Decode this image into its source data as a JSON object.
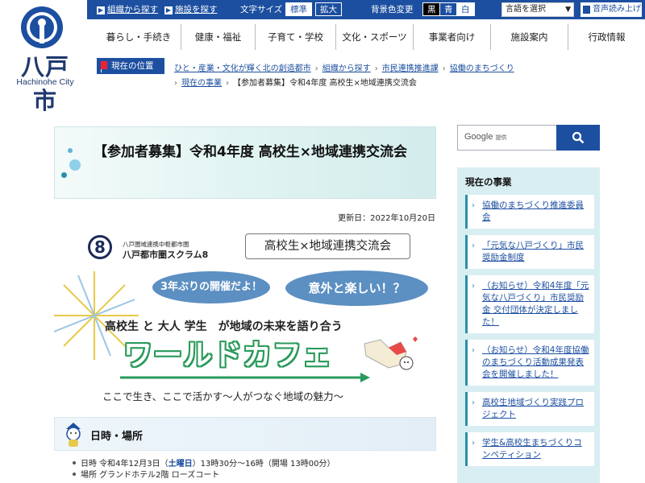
{
  "logo": {
    "city": "八戸市",
    "en": "Hachinohe City",
    "icon": "city-emblem-icon"
  },
  "topbar": {
    "search_org": "組織から探す",
    "search_facility": "施設を探す",
    "font_size_label": "文字サイズ",
    "font_std": "標準",
    "font_big": "拡大",
    "bg_label": "背景色変更",
    "bg_black": "黒",
    "bg_blue": "青",
    "bg_white": "白",
    "lang_select": "言語を選択",
    "read_aloud": "音声読み上げ"
  },
  "nav": {
    "items": [
      "暮らし・手続き",
      "健康・福祉",
      "子育て・学校",
      "文化・スポーツ",
      "事業者向け",
      "施設案内",
      "行政情報"
    ]
  },
  "breadcrumb": {
    "badge": "現在の位置",
    "l1": "ひと・産業・文化が輝く北の創造都市",
    "l2": "組織から探す",
    "l3": "市民連携推進課",
    "l4": "協働のまちづくり",
    "l5": "現在の事業",
    "current": "【参加者募集】令和4年度 高校生×地域連携交流会"
  },
  "main": {
    "title": "【参加者募集】令和4年度 高校生×地域連携交流会",
    "updated": "更新日：2022年10月20日",
    "banner": {
      "scrum_small": "八戸圏域連携中枢都市圏",
      "scrum_big": "八戸都市圏スクラム8",
      "scrum_mark": "8",
      "subtitle": "高校生×地域連携交流会",
      "bubble1": "3年ぶりの開催だよ！",
      "bubble2": "意外と楽しい！？",
      "sub2": "高校生 と 大人 学生　が地域の未来を語り合う",
      "world_cafe": "ワールドカフェ",
      "tagline": "ここで生き、ここで活かす～人がつなぐ地域の魅力～"
    },
    "section_title": "日時・場所",
    "info": {
      "date_prefix": "日時 令和4年12月3日（",
      "date_day": "土曜日",
      "date_suffix": "）13時30分～16時（開場 13時00分）",
      "place": "場所 グランドホテル2階 ローズコート"
    }
  },
  "sidebar": {
    "search_google": "Google",
    "search_provided": "提供",
    "search_icon": "search-icon",
    "panel_title": "現在の事業",
    "items": [
      "協働のまちづくり推進委員会",
      "「元気な八戸づくり」市民奨励金制度",
      "（お知らせ）令和4年度「元気な八戸づくり」市民奨励金 交付団体が決定しました！",
      "（お知らせ）令和4年度協働のまちづくり活動成果発表会を開催しました！",
      "高校生地域づくり実践プロジェクト",
      "学生&高校生まちづくりコンペティション"
    ]
  },
  "colors": {
    "brand": "#1c4fa0",
    "accent": "#2a8fa8",
    "panel": "#d8eef3"
  }
}
